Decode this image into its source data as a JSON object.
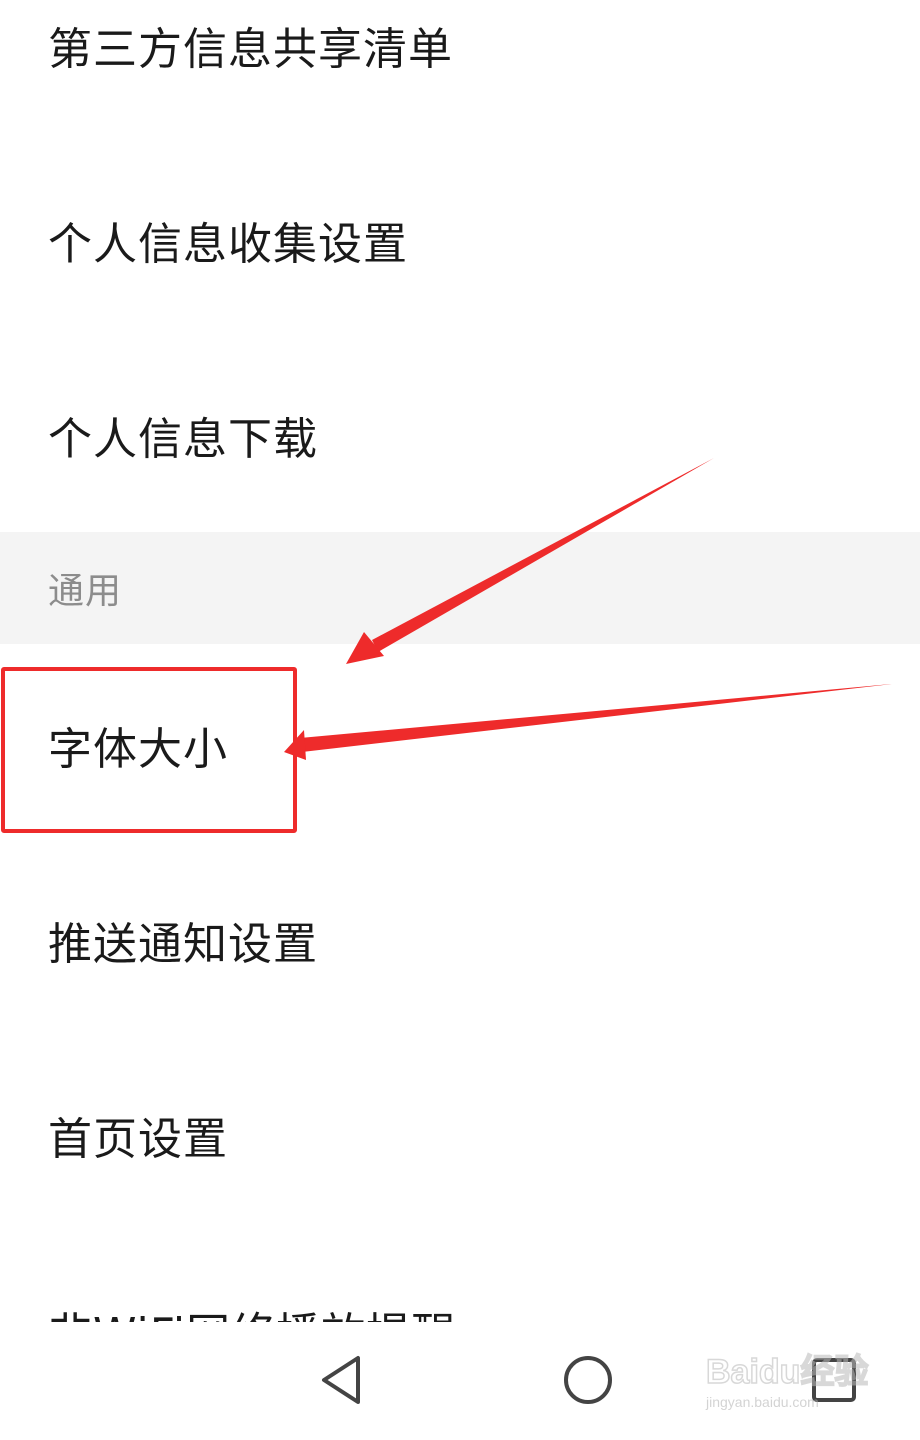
{
  "settings_list": {
    "items": [
      {
        "label": "第三方信息共享清单"
      },
      {
        "label": "个人信息收集设置"
      },
      {
        "label": "个人信息下载"
      }
    ],
    "section_general": {
      "title": "通用",
      "items": [
        {
          "label": "字体大小",
          "highlighted": true
        },
        {
          "label": "推送通知设置"
        },
        {
          "label": "首页设置"
        },
        {
          "label": "非WiFi网络播放提醒"
        }
      ]
    }
  },
  "annotation": {
    "highlight_color": "#ee2b2b",
    "highlighted_item": "字体大小"
  },
  "nav_bar": {
    "back_icon": "triangle-back-icon",
    "home_icon": "circle-home-icon",
    "recents_icon": "square-recents-icon"
  },
  "watermark": {
    "brand": "Baidu经验",
    "url": "jingyan.baidu.com"
  }
}
